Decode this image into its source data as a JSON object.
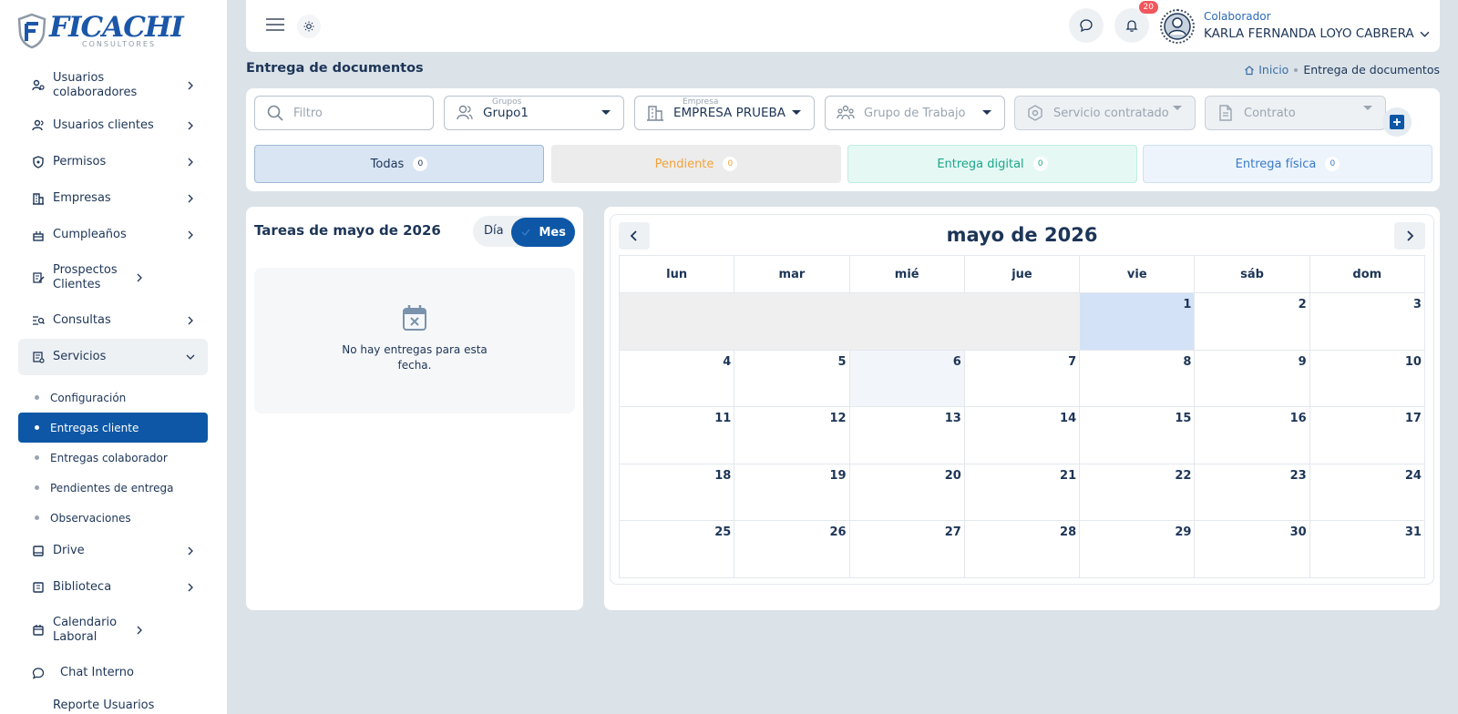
{
  "logo": {
    "main": "FICACHI",
    "sub": "CONSULTORES"
  },
  "sidebar": {
    "items": [
      {
        "label": "Usuarios colaboradores",
        "icon": "users-gear-icon"
      },
      {
        "label": "Usuarios clientes",
        "icon": "user-group-icon"
      },
      {
        "label": "Permisos",
        "icon": "shield-icon"
      },
      {
        "label": "Empresas",
        "icon": "building-icon"
      },
      {
        "label": "Cumpleaños",
        "icon": "cake-icon"
      },
      {
        "label": "Prospectos Clientes",
        "icon": "document-edit-icon"
      },
      {
        "label": "Consultas",
        "icon": "search-list-icon"
      },
      {
        "label": "Servicios",
        "icon": "service-doc-icon"
      }
    ],
    "servicios_sub": [
      {
        "label": "Configuración"
      },
      {
        "label": "Entregas cliente"
      },
      {
        "label": "Entregas colaborador"
      },
      {
        "label": "Pendientes de entrega"
      },
      {
        "label": "Observaciones"
      }
    ],
    "items_after": [
      {
        "label": "Drive",
        "icon": "drive-icon"
      },
      {
        "label": "Biblioteca",
        "icon": "book-icon"
      },
      {
        "label": "Calendario Laboral",
        "icon": "calendar-icon"
      }
    ],
    "chat": {
      "label": "Chat Interno"
    },
    "cut_label": "Reporte Usuarios"
  },
  "topbar": {
    "notifications_count": "20",
    "user_role": "Colaborador",
    "user_name": "KARLA FERNANDA LOYO CABRERA"
  },
  "page": {
    "title": "Entrega de documentos",
    "breadcrumb_home": "Inicio",
    "breadcrumb_current": "Entrega de documentos"
  },
  "filters": {
    "search_placeholder": "Filtro",
    "grupos_label": "Grupos",
    "grupos_value": "Grupo1",
    "empresa_label": "Empresa",
    "empresa_value": "EMPRESA PRUEBA",
    "grupo_trabajo_placeholder": "Grupo de Trabajo",
    "servicio_placeholder": "Servicio contratado",
    "contrato_placeholder": "Contrato"
  },
  "status_tabs": [
    {
      "label": "Todas",
      "count": "0",
      "bg": "#d9e5f3",
      "color": "#1d3557",
      "border": "#9fb8d6"
    },
    {
      "label": "Pendiente",
      "count": "0",
      "bg": "#ececec",
      "color": "#f2a33a",
      "border": "#ececec"
    },
    {
      "label": "Entrega digital",
      "count": "0",
      "bg": "#e6f8f4",
      "color": "#1aa88a",
      "border": "#bfece0"
    },
    {
      "label": "Entrega física",
      "count": "0",
      "bg": "#edf4fc",
      "color": "#3a7bc8",
      "border": "#cfe0f3"
    }
  ],
  "tasks": {
    "title": "Tareas de mayo de 2026",
    "toggle_day": "Día",
    "toggle_month": "Mes",
    "empty_message": "No hay entregas para esta fecha."
  },
  "calendar": {
    "title": "mayo de 2026",
    "weekdays": [
      "lun",
      "mar",
      "mié",
      "jue",
      "vie",
      "sáb",
      "dom"
    ],
    "weeks": [
      [
        "",
        "",
        "",
        "",
        "1",
        "2",
        "3"
      ],
      [
        "4",
        "5",
        "6",
        "7",
        "8",
        "9",
        "10"
      ],
      [
        "11",
        "12",
        "13",
        "14",
        "15",
        "16",
        "17"
      ],
      [
        "18",
        "19",
        "20",
        "21",
        "22",
        "23",
        "24"
      ],
      [
        "25",
        "26",
        "27",
        "28",
        "29",
        "30",
        "31"
      ]
    ],
    "selected_day": "1",
    "highlighted_day": "6"
  },
  "colors": {
    "primary": "#0d57a6",
    "text": "#1d3557",
    "background": "#dbe3e9"
  }
}
